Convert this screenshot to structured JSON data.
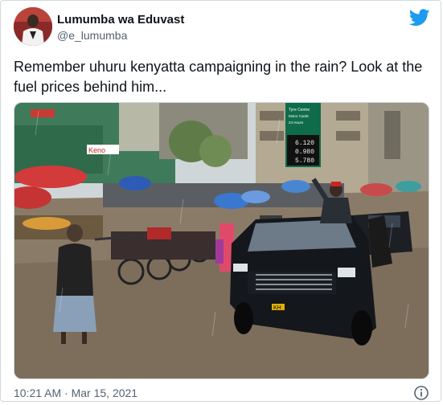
{
  "tweet": {
    "display_name": "Lumumba wa Eduvast",
    "handle": "@e_lumumba",
    "text": "Remember uhuru kenyatta campaigning in the rain? Look at the fuel prices behind him...",
    "timestamp": "10:21 AM · Mar 15, 2021",
    "brand_icon": "twitter-bird-icon",
    "info_icon": "info-icon"
  },
  "photo": {
    "price_board": {
      "header": [
        "Tyre Centre",
        "Motor Cards",
        "24 Hours"
      ],
      "prices": [
        "6.120",
        "0.980",
        "5.780"
      ]
    },
    "shop_sign": "Keno",
    "plate": "KH"
  }
}
